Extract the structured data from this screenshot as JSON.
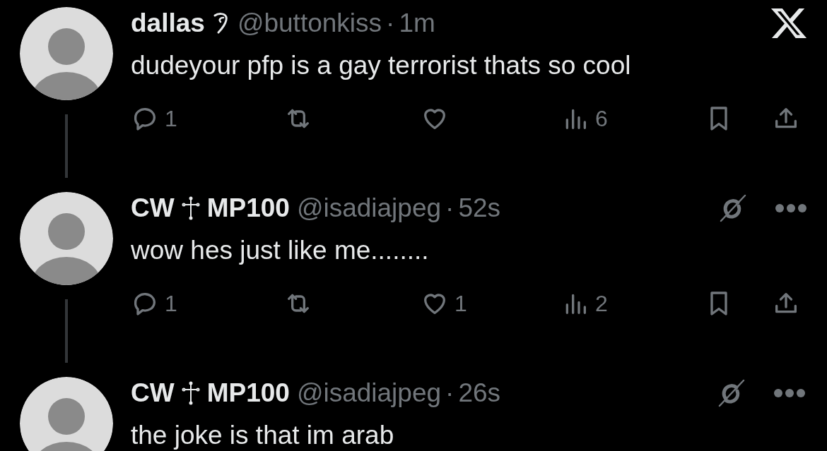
{
  "tweets": [
    {
      "kind": "post",
      "name": "dallas",
      "handle": "@buttonkiss",
      "separator": "·",
      "time": "1m",
      "text": "dudeyour pfp is a gay terrorist thats so cool",
      "actions": [
        {
          "kind": "reply",
          "count": "1"
        },
        {
          "kind": "repost"
        },
        {
          "kind": "like"
        },
        {
          "kind": "views",
          "count": "6"
        },
        {
          "kind": "bookmark"
        },
        {
          "kind": "share"
        }
      ]
    },
    {
      "kind": "reply",
      "name_parts": [
        "CW",
        "MP100"
      ],
      "handle": "@isadiajpeg",
      "separator": "·",
      "time": "52s",
      "text": "wow hes just like me........",
      "actions": [
        {
          "kind": "reply",
          "count": "1"
        },
        {
          "kind": "repost"
        },
        {
          "kind": "like",
          "count": "1"
        },
        {
          "kind": "views",
          "count": "2"
        },
        {
          "kind": "bookmark"
        },
        {
          "kind": "share"
        }
      ]
    },
    {
      "kind": "reply",
      "name_parts": [
        "CW",
        "MP100"
      ],
      "handle": "@isadiajpeg",
      "separator": "·",
      "time": "26s",
      "text": "the joke is that im arab"
    }
  ]
}
